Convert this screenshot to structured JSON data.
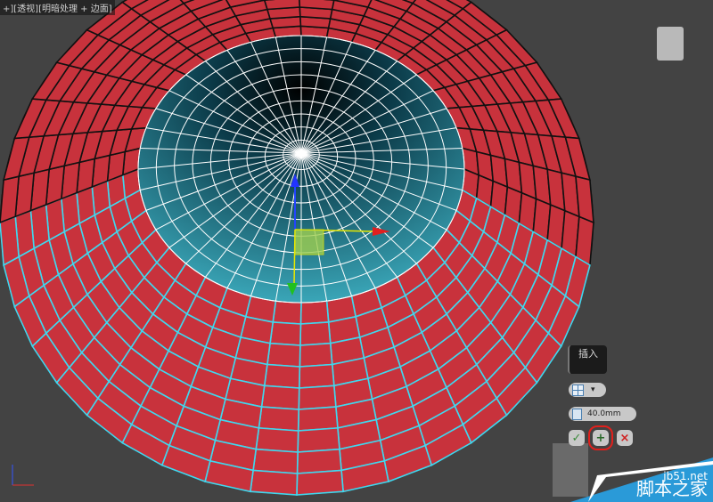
{
  "viewport": {
    "label": "+][透视][明暗处理 + 边面]"
  },
  "caddy": {
    "title": "插入",
    "mode_value": "▾",
    "amount_value": "40.0mm",
    "ok_icon": "check-icon",
    "apply_icon": "plus-icon",
    "cancel_icon": "close-icon"
  },
  "watermark": {
    "site": "jb51.net",
    "name": "脚本之家"
  },
  "colors": {
    "faces": "#c8323c",
    "hole": "#1c7f93",
    "edges": "#ffffff",
    "selection": "#3fd8ef",
    "highlight": "#e0201c"
  }
}
